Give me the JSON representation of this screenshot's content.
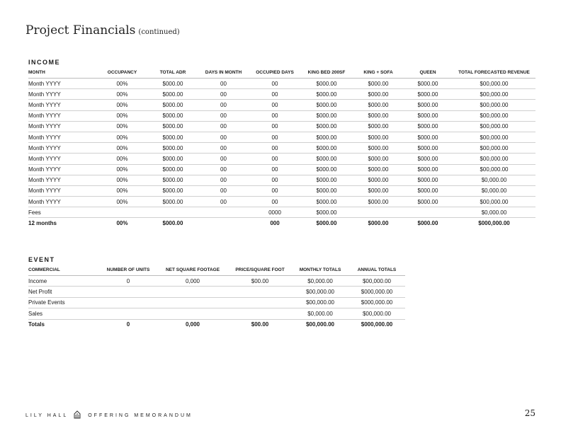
{
  "header": {
    "title": "Project Financials",
    "subtitle": "(continued)"
  },
  "income": {
    "section_label": "INCOME",
    "columns": [
      "MONTH",
      "OCCUPANCY",
      "TOTAL ADR",
      "DAYS IN MONTH",
      "OCCUPIED DAYS",
      "KING BED 200SF",
      "KING + SOFA",
      "QUEEN",
      "TOTAL FORECASTED REVENUE"
    ],
    "rows": [
      [
        "Month YYYY",
        "00%",
        "$000.00",
        "00",
        "00",
        "$000.00",
        "$000.00",
        "$000.00",
        "$00,000.00"
      ],
      [
        "Month YYYY",
        "00%",
        "$000.00",
        "00",
        "00",
        "$000.00",
        "$000.00",
        "$000.00",
        "$00,000.00"
      ],
      [
        "Month YYYY",
        "00%",
        "$000.00",
        "00",
        "00",
        "$000.00",
        "$000.00",
        "$000.00",
        "$00,000.00"
      ],
      [
        "Month YYYY",
        "00%",
        "$000.00",
        "00",
        "00",
        "$000.00",
        "$000.00",
        "$000.00",
        "$00,000.00"
      ],
      [
        "Month YYYY",
        "00%",
        "$000.00",
        "00",
        "00",
        "$000.00",
        "$000.00",
        "$000.00",
        "$00,000.00"
      ],
      [
        "Month YYYY",
        "00%",
        "$000.00",
        "00",
        "00",
        "$000.00",
        "$000.00",
        "$000.00",
        "$00,000.00"
      ],
      [
        "Month YYYY",
        "00%",
        "$000.00",
        "00",
        "00",
        "$000.00",
        "$000.00",
        "$000.00",
        "$00,000.00"
      ],
      [
        "Month YYYY",
        "00%",
        "$000.00",
        "00",
        "00",
        "$000.00",
        "$000.00",
        "$000.00",
        "$00,000.00"
      ],
      [
        "Month YYYY",
        "00%",
        "$000.00",
        "00",
        "00",
        "$000.00",
        "$000.00",
        "$000.00",
        "$00,000.00"
      ],
      [
        "Month YYYY",
        "00%",
        "$000.00",
        "00",
        "00",
        "$000.00",
        "$000.00",
        "$000.00",
        "$0,000.00"
      ],
      [
        "Month YYYY",
        "00%",
        "$000.00",
        "00",
        "00",
        "$000.00",
        "$000.00",
        "$000.00",
        "$0,000.00"
      ],
      [
        "Month YYYY",
        "00%",
        "$000.00",
        "00",
        "00",
        "$000.00",
        "$000.00",
        "$000.00",
        "$00,000.00"
      ],
      [
        "Fees",
        "",
        "",
        "",
        "0000",
        "$000.00",
        "",
        "",
        "$0,000.00"
      ]
    ],
    "total_row": [
      "12 months",
      "00%",
      "$000.00",
      "",
      "000",
      "$000.00",
      "$000.00",
      "$000.00",
      "$000,000.00"
    ]
  },
  "event": {
    "section_label": "EVENT",
    "columns": [
      "COMMERCIAL",
      "NUMBER OF UNITS",
      "NET SQUARE FOOTAGE",
      "PRICE/SQUARE FOOT",
      "MONTHLY TOTALS",
      "ANNUAL TOTALS"
    ],
    "rows": [
      [
        "Income",
        "0",
        "0,000",
        "$00.00",
        "$0,000.00",
        "$00,000.00"
      ],
      [
        "Net Profit",
        "",
        "",
        "",
        "$00,000.00",
        "$000,000.00"
      ],
      [
        "Private Events",
        "",
        "",
        "",
        "$00,000.00",
        "$000,000.00"
      ],
      [
        "Sales",
        "",
        "",
        "",
        "$0,000.00",
        "$00,000.00"
      ]
    ],
    "total_row": [
      "Totals",
      "0",
      "0,000",
      "$00.00",
      "$00,000.00",
      "$000,000.00"
    ]
  },
  "footer": {
    "brand": "LILY HALL",
    "doc": "OFFERING MEMORANDUM",
    "logo_icon": "building-logo-icon",
    "page": "25"
  }
}
